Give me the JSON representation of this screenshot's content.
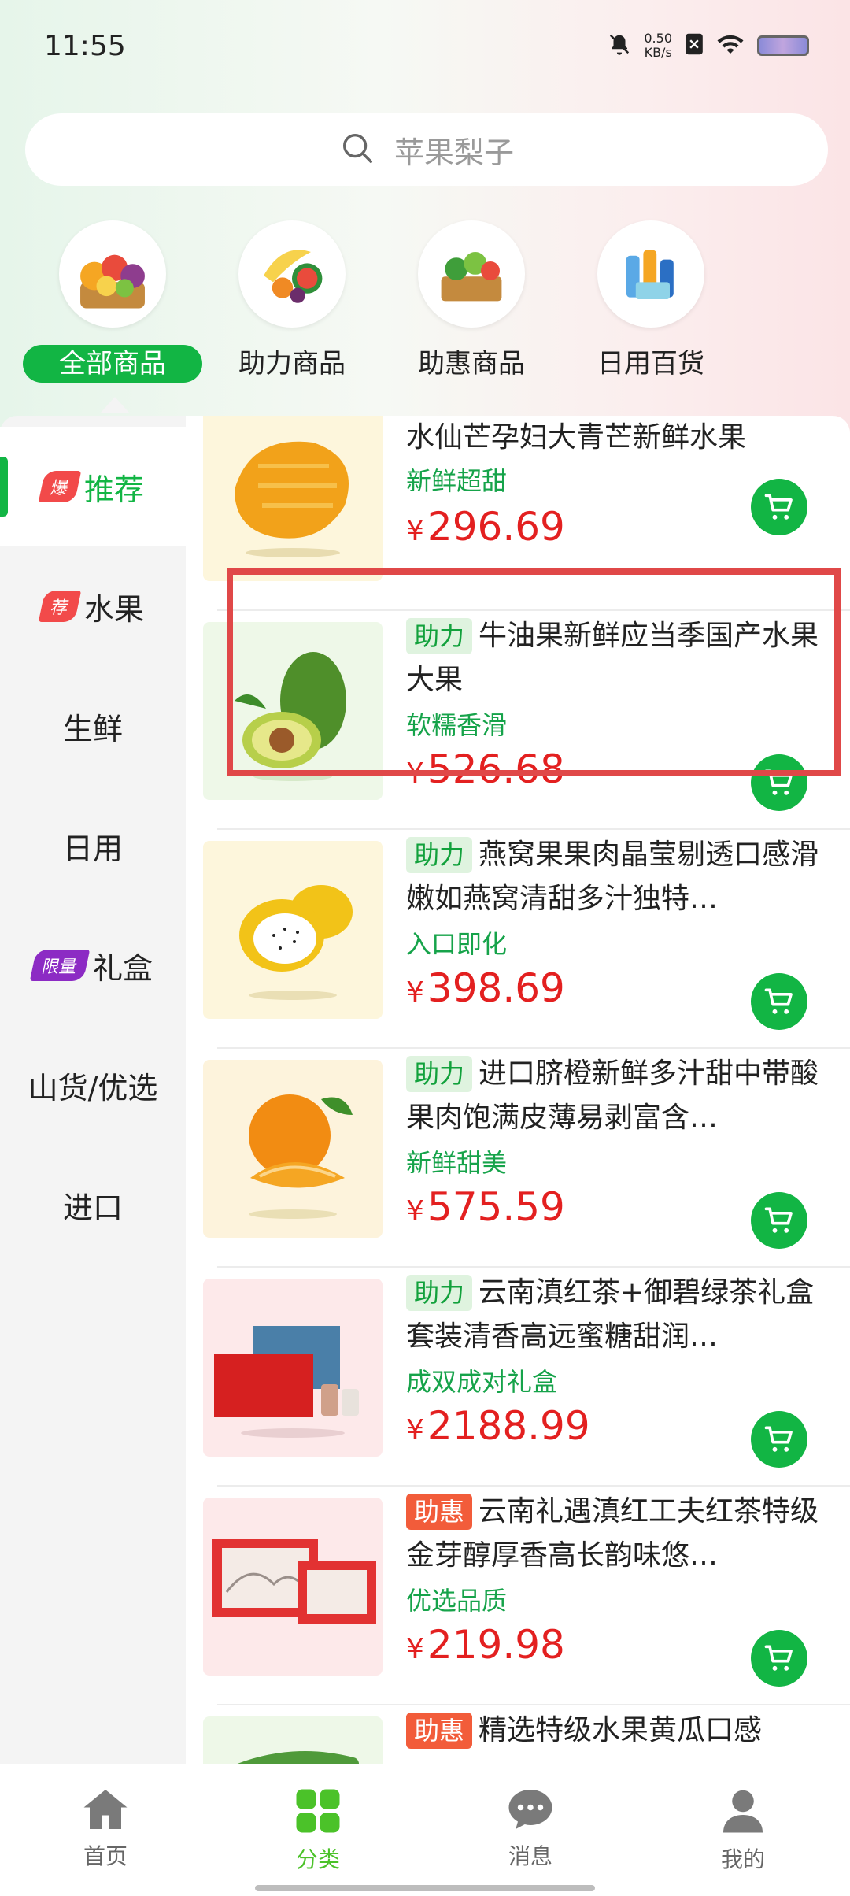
{
  "status_bar": {
    "time": "11:55",
    "net_speed": "0.50",
    "net_unit": "KB/s"
  },
  "search": {
    "placeholder": "苹果梨子"
  },
  "top_categories": [
    {
      "label": "全部商品",
      "active": true
    },
    {
      "label": "助力商品",
      "active": false
    },
    {
      "label": "助惠商品",
      "active": false
    },
    {
      "label": "日用百货",
      "active": false
    }
  ],
  "sidebar": {
    "items": [
      {
        "label": "推荐",
        "badge": "爆",
        "active": true
      },
      {
        "label": "水果",
        "badge": "荐"
      },
      {
        "label": "生鲜"
      },
      {
        "label": "日用"
      },
      {
        "label": "礼盒",
        "badge": "限量"
      },
      {
        "label": "山货/优选"
      },
      {
        "label": "进口"
      }
    ]
  },
  "products": [
    {
      "title": "水仙芒孕妇大青芒新鲜水果",
      "subtitle": "新鲜超甜",
      "currency": "¥",
      "price": "296.69"
    },
    {
      "tag": "助力",
      "title": "牛油果新鲜应当季国产水果大果",
      "subtitle": "软糯香滑",
      "currency": "¥",
      "price": "526.68"
    },
    {
      "tag": "助力",
      "title": "燕窝果果肉晶莹剔透口感滑嫩如燕窝清甜多汁独特…",
      "subtitle": "入口即化",
      "currency": "¥",
      "price": "398.69"
    },
    {
      "tag": "助力",
      "title": "进口脐橙新鲜多汁甜中带酸果肉饱满皮薄易剥富含…",
      "subtitle": "新鲜甜美",
      "currency": "¥",
      "price": "575.59"
    },
    {
      "tag": "助力",
      "title": "云南滇红茶+御碧绿茶礼盒套装清香高远蜜糖甜润…",
      "subtitle": "成双成对礼盒",
      "currency": "¥",
      "price": "2188.99"
    },
    {
      "tag": "助惠",
      "title": "云南礼遇滇红工夫红茶特级金芽醇厚香高长韵味悠…",
      "subtitle": "优选品质",
      "currency": "¥",
      "price": "219.98"
    },
    {
      "tag": "助惠",
      "title": "精选特级水果黄瓜口感",
      "subtitle": "",
      "currency": "",
      "price": ""
    }
  ],
  "bottom_nav": [
    {
      "label": "首页"
    },
    {
      "label": "分类",
      "active": true
    },
    {
      "label": "消息"
    },
    {
      "label": "我的"
    }
  ],
  "colors": {
    "accent": "#12b544",
    "price": "#e32020",
    "highlight": "#e04848"
  }
}
